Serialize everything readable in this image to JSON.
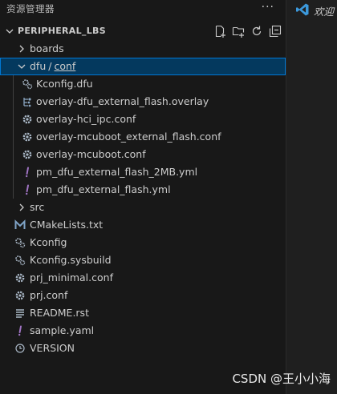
{
  "explorer": {
    "title": "资源管理器",
    "more_label": "···",
    "project_name": "PERIPHERAL_LBS",
    "actions": [
      "new-file-icon",
      "new-folder-icon",
      "refresh-icon",
      "collapse-all-icon"
    ]
  },
  "tree": {
    "boards": "boards",
    "dfu_folder": "dfu",
    "conf_folder": "conf",
    "dfu_children": [
      "Kconfig.dfu",
      "overlay-dfu_external_flash.overlay",
      "overlay-hci_ipc.conf",
      "overlay-mcuboot_external_flash.conf",
      "overlay-mcuboot.conf",
      "pm_dfu_external_flash_2MB.yml",
      "pm_dfu_external_flash.yml"
    ],
    "src": "src",
    "root_files": [
      "CMakeLists.txt",
      "Kconfig",
      "Kconfig.sysbuild",
      "prj_minimal.conf",
      "prj.conf",
      "README.rst",
      "sample.yaml",
      "VERSION"
    ]
  },
  "editor": {
    "welcome_tab": "欢迎"
  },
  "watermark": "CSDN @王小小海",
  "colors": {
    "sidebar_bg": "#181818",
    "editor_bg": "#1f1f1f",
    "selection_bg": "#04395e",
    "selection_border": "#0078d4",
    "text": "#cccccc",
    "yaml_accent": "#a074c4",
    "cmake_accent": "#6d8086",
    "vscode_blue": "#3c99dc"
  }
}
